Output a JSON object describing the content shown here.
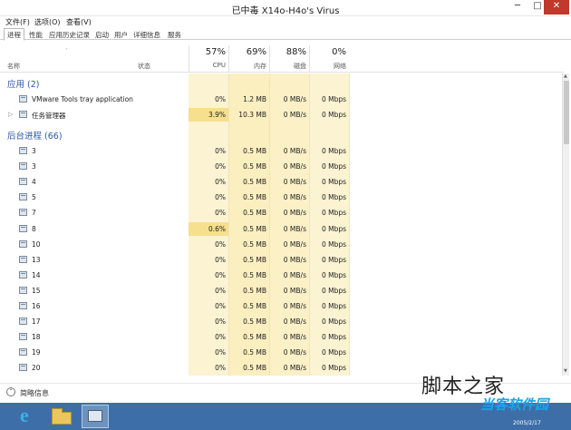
{
  "window": {
    "title": "已中毒 X14o-H4o's Virus",
    "buttons": {
      "minimize": "─",
      "maximize": "□",
      "close": "✕"
    }
  },
  "menu": [
    "文件(F)",
    "选项(O)",
    "查看(V)"
  ],
  "tabs": [
    {
      "label": "进程",
      "active": true
    },
    {
      "label": "性能",
      "active": false
    },
    {
      "label": "应用历史记录",
      "active": false
    },
    {
      "label": "启动",
      "active": false
    },
    {
      "label": "用户",
      "active": false
    },
    {
      "label": "详细信息",
      "active": false
    },
    {
      "label": "服务",
      "active": false
    }
  ],
  "columns": {
    "sort_icon": "sort-up-icon",
    "sort_glyph": "˄",
    "name": "名称",
    "status": "状态",
    "cpu": {
      "percent": "57%",
      "label": "CPU"
    },
    "memory": {
      "percent": "69%",
      "label": "内存"
    },
    "disk": {
      "percent": "88%",
      "label": "磁盘"
    },
    "network": {
      "percent": "0%",
      "label": "网络"
    }
  },
  "groups": {
    "apps": {
      "label": "应用 (2)"
    },
    "background": {
      "label": "后台进程 (66)"
    }
  },
  "apps": [
    {
      "name": "VMware Tools tray application",
      "cpu": "0%",
      "mem": "1.2 MB",
      "disk": "0 MB/s",
      "net": "0 Mbps",
      "expandable": false
    },
    {
      "name": "任务管理器",
      "cpu": "3.9%",
      "mem": "10.3 MB",
      "disk": "0 MB/s",
      "net": "0 Mbps",
      "expandable": true
    }
  ],
  "background": [
    {
      "name": "3",
      "cpu": "0%",
      "mem": "0.5 MB",
      "disk": "0 MB/s",
      "net": "0 Mbps"
    },
    {
      "name": "3",
      "cpu": "0%",
      "mem": "0.5 MB",
      "disk": "0 MB/s",
      "net": "0 Mbps"
    },
    {
      "name": "4",
      "cpu": "0%",
      "mem": "0.5 MB",
      "disk": "0 MB/s",
      "net": "0 Mbps"
    },
    {
      "name": "5",
      "cpu": "0%",
      "mem": "0.5 MB",
      "disk": "0 MB/s",
      "net": "0 Mbps"
    },
    {
      "name": "7",
      "cpu": "0%",
      "mem": "0.5 MB",
      "disk": "0 MB/s",
      "net": "0 Mbps"
    },
    {
      "name": "8",
      "cpu": "0.6%",
      "mem": "0.5 MB",
      "disk": "0 MB/s",
      "net": "0 Mbps"
    },
    {
      "name": "10",
      "cpu": "0%",
      "mem": "0.5 MB",
      "disk": "0 MB/s",
      "net": "0 Mbps"
    },
    {
      "name": "13",
      "cpu": "0%",
      "mem": "0.5 MB",
      "disk": "0 MB/s",
      "net": "0 Mbps"
    },
    {
      "name": "14",
      "cpu": "0%",
      "mem": "0.5 MB",
      "disk": "0 MB/s",
      "net": "0 Mbps"
    },
    {
      "name": "15",
      "cpu": "0%",
      "mem": "0.5 MB",
      "disk": "0 MB/s",
      "net": "0 Mbps"
    },
    {
      "name": "16",
      "cpu": "0%",
      "mem": "0.5 MB",
      "disk": "0 MB/s",
      "net": "0 Mbps"
    },
    {
      "name": "17",
      "cpu": "0%",
      "mem": "0.5 MB",
      "disk": "0 MB/s",
      "net": "0 Mbps"
    },
    {
      "name": "18",
      "cpu": "0%",
      "mem": "0.5 MB",
      "disk": "0 MB/s",
      "net": "0 Mbps"
    },
    {
      "name": "19",
      "cpu": "0%",
      "mem": "0.5 MB",
      "disk": "0 MB/s",
      "net": "0 Mbps"
    },
    {
      "name": "20",
      "cpu": "0%",
      "mem": "0.5 MB",
      "disk": "0 MB/s",
      "net": "0 Mbps"
    }
  ],
  "footer": {
    "toggle_icon": "chevron-up-icon",
    "toggle_glyph": "⌃",
    "label": "简略信息"
  },
  "watermark": {
    "text": "脚本之家",
    "url": "www.jb51.net"
  },
  "taskbar": {
    "items": [
      "internet-explorer-icon",
      "file-explorer-icon",
      "task-manager-icon"
    ],
    "ie_glyph": "e",
    "brand": "当客软件园",
    "date": "2005/2/17"
  },
  "colors": {
    "cpu_column": "#fbf3d2",
    "memory_column": "#fbeebf",
    "disk_column": "#fbf0c6",
    "network_column": "#fbf3d2",
    "highlight_cell": "#f6df8e",
    "group_label": "#2a5aa8",
    "close_button": "#c0392b",
    "taskbar": "#3e6ea8"
  }
}
